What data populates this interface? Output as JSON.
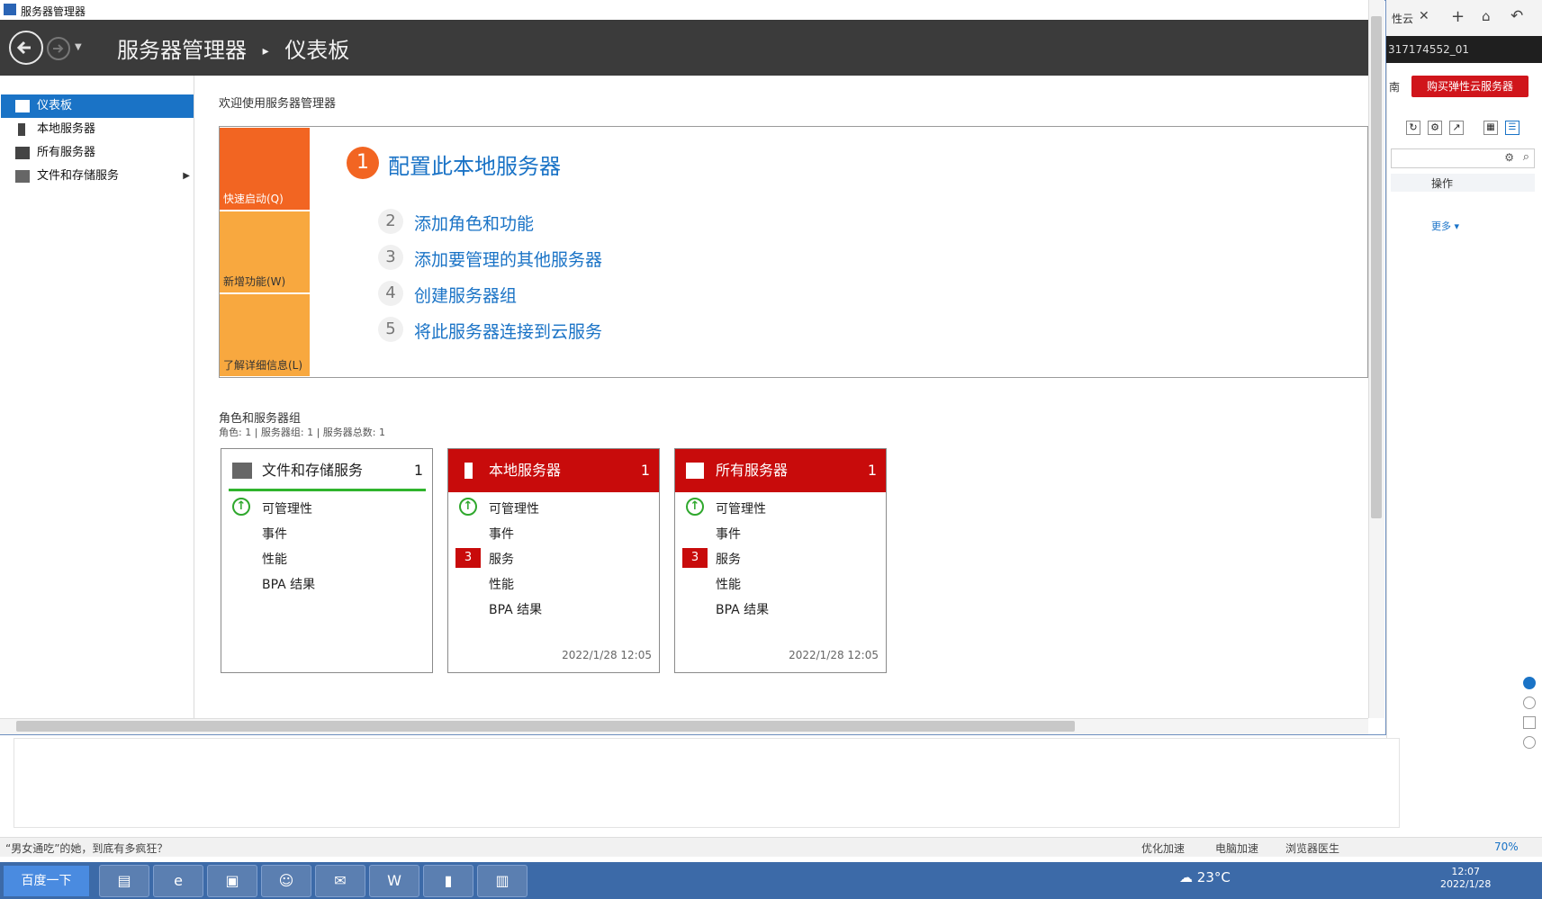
{
  "window": {
    "title": "服务器管理器"
  },
  "header": {
    "app": "服务器管理器",
    "sep": "▸",
    "page": "仪表板"
  },
  "sidebar": {
    "items": [
      {
        "label": "仪表板"
      },
      {
        "label": "本地服务器"
      },
      {
        "label": "所有服务器"
      },
      {
        "label": "文件和存储服务"
      }
    ]
  },
  "welcome": {
    "title": "欢迎使用服务器管理器"
  },
  "quickstart": {
    "tiles": [
      "快速启动(Q)",
      "新增功能(W)",
      "了解详细信息(L)"
    ],
    "steps": [
      {
        "num": "1",
        "label": "配置此本地服务器"
      },
      {
        "num": "2",
        "label": "添加角色和功能"
      },
      {
        "num": "3",
        "label": "添加要管理的其他服务器"
      },
      {
        "num": "4",
        "label": "创建服务器组"
      },
      {
        "num": "5",
        "label": "将此服务器连接到云服务"
      }
    ]
  },
  "roles": {
    "title": "角色和服务器组",
    "summary": "角色: 1 | 服务器组: 1 | 服务器总数: 1",
    "cards": [
      {
        "title": "文件和存储服务",
        "count": "1",
        "rows": [
          "可管理性",
          "事件",
          "性能",
          "BPA 结果"
        ]
      },
      {
        "title": "本地服务器",
        "count": "1",
        "rows": [
          "可管理性",
          "事件",
          "服务",
          "性能",
          "BPA 结果"
        ],
        "badge": "3",
        "time": "2022/1/28 12:05"
      },
      {
        "title": "所有服务器",
        "count": "1",
        "rows": [
          "可管理性",
          "事件",
          "服务",
          "性能",
          "BPA 结果"
        ],
        "badge": "3",
        "time": "2022/1/28 12:05"
      }
    ]
  },
  "browser": {
    "tab": "性云",
    "id": "317174552_01",
    "nav_frag": "南",
    "buy": "购买弹性云服务器",
    "col_action": "操作",
    "more": "更多",
    "status_left": "“男女通吃”的她，到底有多疯狂？",
    "status_items": [
      "优化加速",
      "电脑加速",
      "浏览器医生"
    ],
    "zoom": "70%"
  },
  "taskbar": {
    "start": "百度一下",
    "temp": "23°C",
    "time": "12:07",
    "date": "2022/1/28"
  },
  "colors": {
    "accent": "#1a73c6",
    "orange": "#f26522",
    "tile": "#f8a83f",
    "red": "#c80b0b",
    "green": "#30b42d"
  }
}
